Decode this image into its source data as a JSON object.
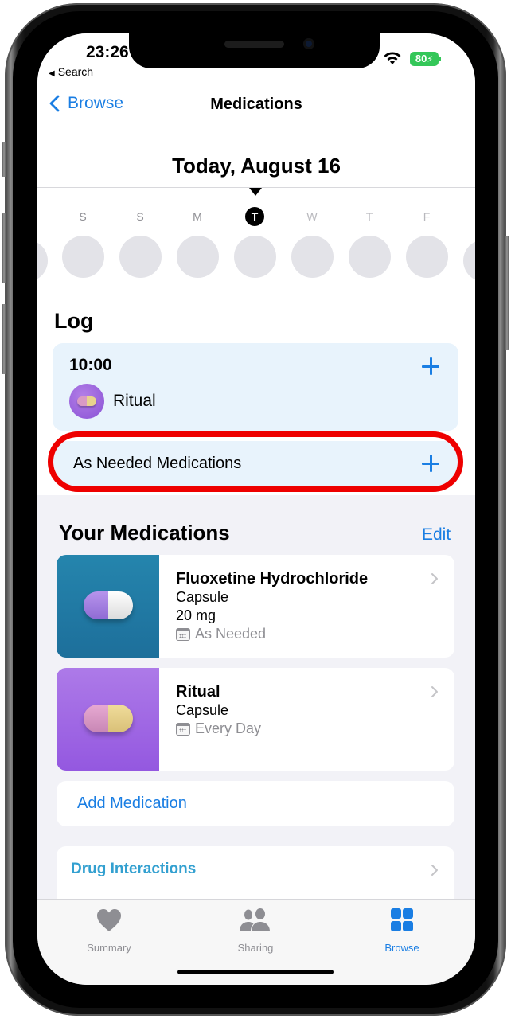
{
  "status_bar": {
    "time": "23:26",
    "back_app": "Search",
    "battery": "80",
    "battery_color": "#34c759"
  },
  "nav": {
    "back_label": "Browse",
    "title": "Medications"
  },
  "date_header": {
    "title": "Today, August 16"
  },
  "week": {
    "days": [
      {
        "letter": "S",
        "state": "past"
      },
      {
        "letter": "S",
        "state": "past"
      },
      {
        "letter": "M",
        "state": "past"
      },
      {
        "letter": "T",
        "state": "today"
      },
      {
        "letter": "W",
        "state": "future"
      },
      {
        "letter": "T",
        "state": "future"
      },
      {
        "letter": "F",
        "state": "future"
      }
    ]
  },
  "log": {
    "title": "Log",
    "scheduled": {
      "time": "10:00",
      "medication": "Ritual"
    },
    "as_needed_label": "As Needed Medications",
    "highlight_color": "#ee0000"
  },
  "your_medications": {
    "title": "Your Medications",
    "edit_label": "Edit",
    "items": [
      {
        "name": "Fluoxetine Hydrochloride",
        "form": "Capsule",
        "strength": "20 mg",
        "schedule": "As Needed",
        "thumb_color": "#2585ad",
        "capsule_colors": [
          "#a07ee0",
          "#f4f4f4"
        ]
      },
      {
        "name": "Ritual",
        "form": "Capsule",
        "strength": null,
        "schedule": "Every Day",
        "thumb_color": "#ad7ae8",
        "capsule_colors": [
          "#d99ac4",
          "#e8d38d"
        ]
      }
    ],
    "add_label": "Add Medication"
  },
  "drug_interactions": {
    "label": "Drug Interactions"
  },
  "tabbar": {
    "tabs": [
      {
        "label": "Summary",
        "icon": "heart-icon",
        "active": false
      },
      {
        "label": "Sharing",
        "icon": "people-icon",
        "active": false
      },
      {
        "label": "Browse",
        "icon": "grid-icon",
        "active": true
      }
    ]
  },
  "colors": {
    "accent": "#1a7ee3",
    "log_card_bg": "#e8f3fc",
    "grouped_bg": "#f2f2f7"
  }
}
